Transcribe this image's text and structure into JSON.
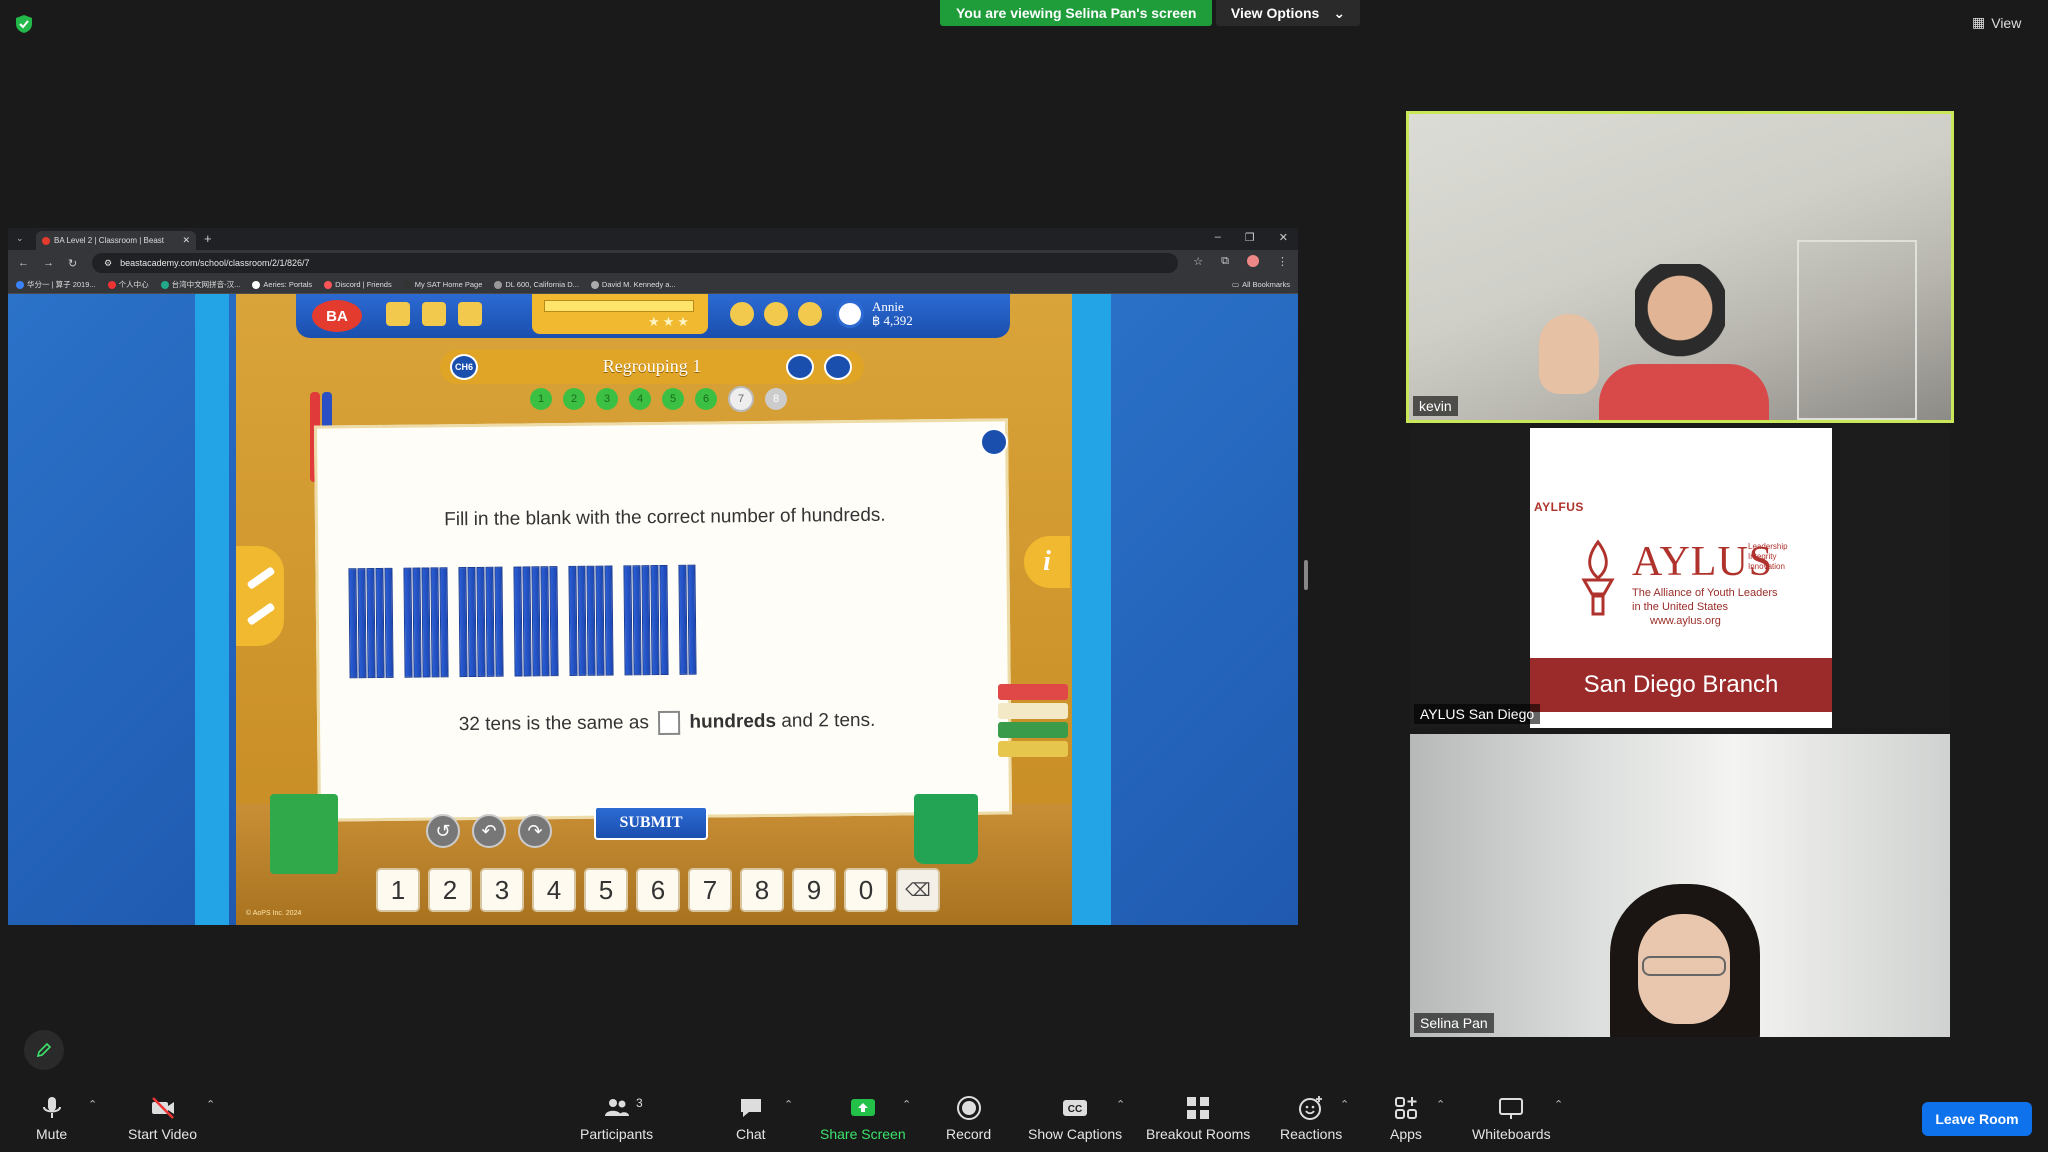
{
  "banner": {
    "viewing": "You are viewing Selina Pan's screen",
    "view_options": "View Options",
    "view": "View"
  },
  "browser": {
    "tab_title": "BA Level 2 | Classroom | Beast",
    "url": "beastacademy.com/school/classroom/2/1/826/7",
    "bookmarks": [
      "华分一 | 算子 2019...",
      "个人中心",
      "台湾中文网拼音-汉...",
      "Aeries: Portals",
      "Discord | Friends",
      "My SAT Home Page",
      "DL 600, California D...",
      "David M. Kennedy a..."
    ],
    "all_bookmarks": "All Bookmarks"
  },
  "game": {
    "logo": "BA",
    "user_name": "Annie",
    "user_coins": "฿ 4,392",
    "chapter": "CH6",
    "lesson": "Regrouping 1",
    "progress_dots": [
      "1",
      "2",
      "3",
      "4",
      "5",
      "6",
      "7",
      "8"
    ],
    "prompt": "Fill in the blank with the correct number of hundreds.",
    "answer_pre": "32 tens is the same as",
    "answer_bold": "hundreds",
    "answer_post": "and 2 tens.",
    "submit": "SUBMIT",
    "keys": [
      "1",
      "2",
      "3",
      "4",
      "5",
      "6",
      "7",
      "8",
      "9",
      "0"
    ],
    "info": "i",
    "copyright": "© AoPS Inc. 2024"
  },
  "participants": {
    "kevin": "kevin",
    "aylus_tile": "AYLUS San Diego",
    "selina": "Selina Pan",
    "aylus_small": "AYLFUS",
    "aylus_big": "AYLUS",
    "aylus_tagline": [
      "Leadership",
      "Integrity",
      "Innovation"
    ],
    "aylus_sub1": "The Alliance of Youth Leaders",
    "aylus_sub2": "in the United States",
    "aylus_url": "www.aylus.org",
    "aylus_branch": "San Diego Branch"
  },
  "toolbar": {
    "mute": "Mute",
    "start_video": "Start Video",
    "participants": "Participants",
    "participants_count": "3",
    "chat": "Chat",
    "share_screen": "Share Screen",
    "record": "Record",
    "show_captions": "Show Captions",
    "breakout": "Breakout Rooms",
    "reactions": "Reactions",
    "apps": "Apps",
    "whiteboards": "Whiteboards",
    "leave": "Leave Room"
  },
  "colors": {
    "share_green": "#3ce36a",
    "leave_blue": "#0e72ed",
    "banner_green": "#1f9d3b",
    "active_speaker": "#c8e85a"
  }
}
